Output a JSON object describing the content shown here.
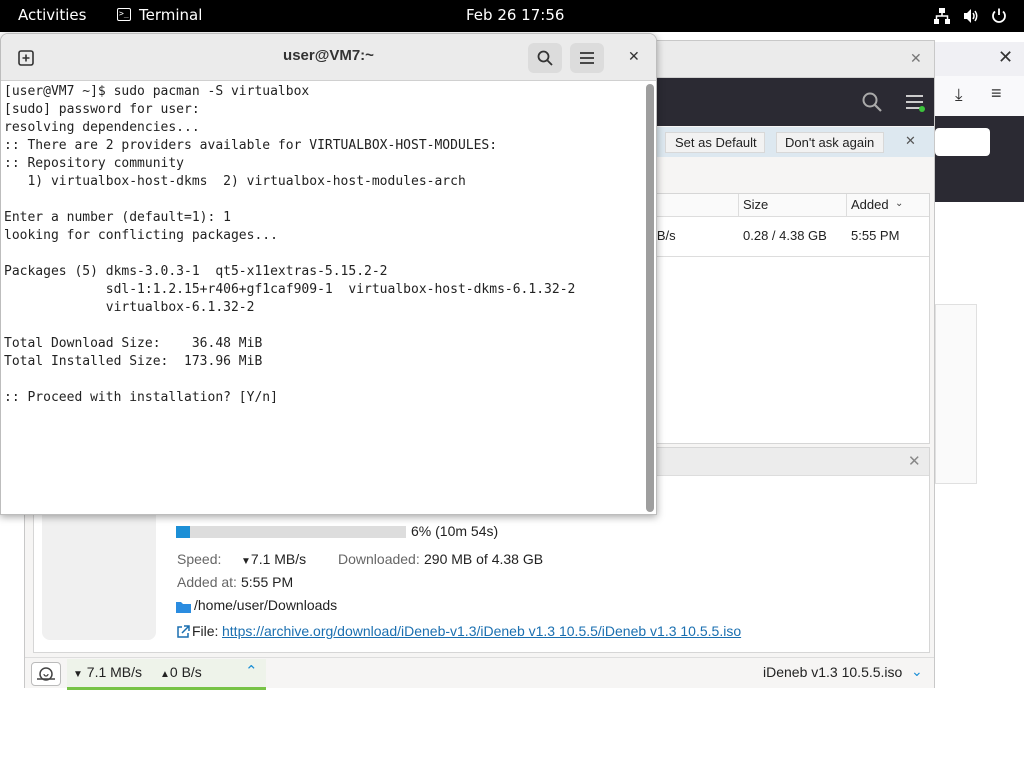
{
  "topbar": {
    "activities": "Activities",
    "app_name": "Terminal",
    "clock": "Feb 26  17:56"
  },
  "terminal": {
    "title": "user@VM7:~",
    "lines": [
      "[user@VM7 ~]$ sudo pacman -S virtualbox",
      "[sudo] password for user:",
      "resolving dependencies...",
      ":: There are 2 providers available for VIRTUALBOX-HOST-MODULES:",
      ":: Repository community",
      "   1) virtualbox-host-dkms  2) virtualbox-host-modules-arch",
      "",
      "Enter a number (default=1): 1",
      "looking for conflicting packages...",
      "",
      "Packages (5) dkms-3.0.3-1  qt5-x11extras-5.15.2-2",
      "             sdl-1:1.2.15+r406+gf1caf909-1  virtualbox-host-dkms-6.1.32-2",
      "             virtualbox-6.1.32-2",
      "",
      "Total Download Size:    36.48 MiB",
      "Total Installed Size:  173.96 MiB",
      "",
      ":: Proceed with installation? [Y/n]"
    ]
  },
  "infobar": {
    "set_default": "Set as Default",
    "dont_ask": "Don't ask again"
  },
  "torrent_table": {
    "headers": {
      "size": "Size",
      "added": "Added"
    },
    "row": {
      "rate": "MB/s",
      "size": "0.28 / 4.38 GB",
      "added": "5:55 PM"
    }
  },
  "details": {
    "progress_fraction": 0.06,
    "progress_text": "6%  (10m 54s)",
    "speed_label": "Speed:",
    "speed_value": "7.1 MB/s",
    "downloaded_label": "Downloaded:",
    "downloaded_value": "290 MB of 4.38 GB",
    "added_label": "Added at:",
    "added_value": "5:55 PM",
    "folder": "/home/user/Downloads",
    "file_label": "File:",
    "file_url": "https://archive.org/download/iDeneb-v1.3/iDeneb v1.3 10.5.5/iDeneb v1.3 10.5.5.iso"
  },
  "statusbar": {
    "down": "7.1 MB/s",
    "up": "0 B/s",
    "filename": "iDeneb v1.3 10.5.5.iso"
  },
  "colors": {
    "accent": "#3584e4",
    "progress": "#1c8fd6",
    "link": "#1a6fb0"
  }
}
